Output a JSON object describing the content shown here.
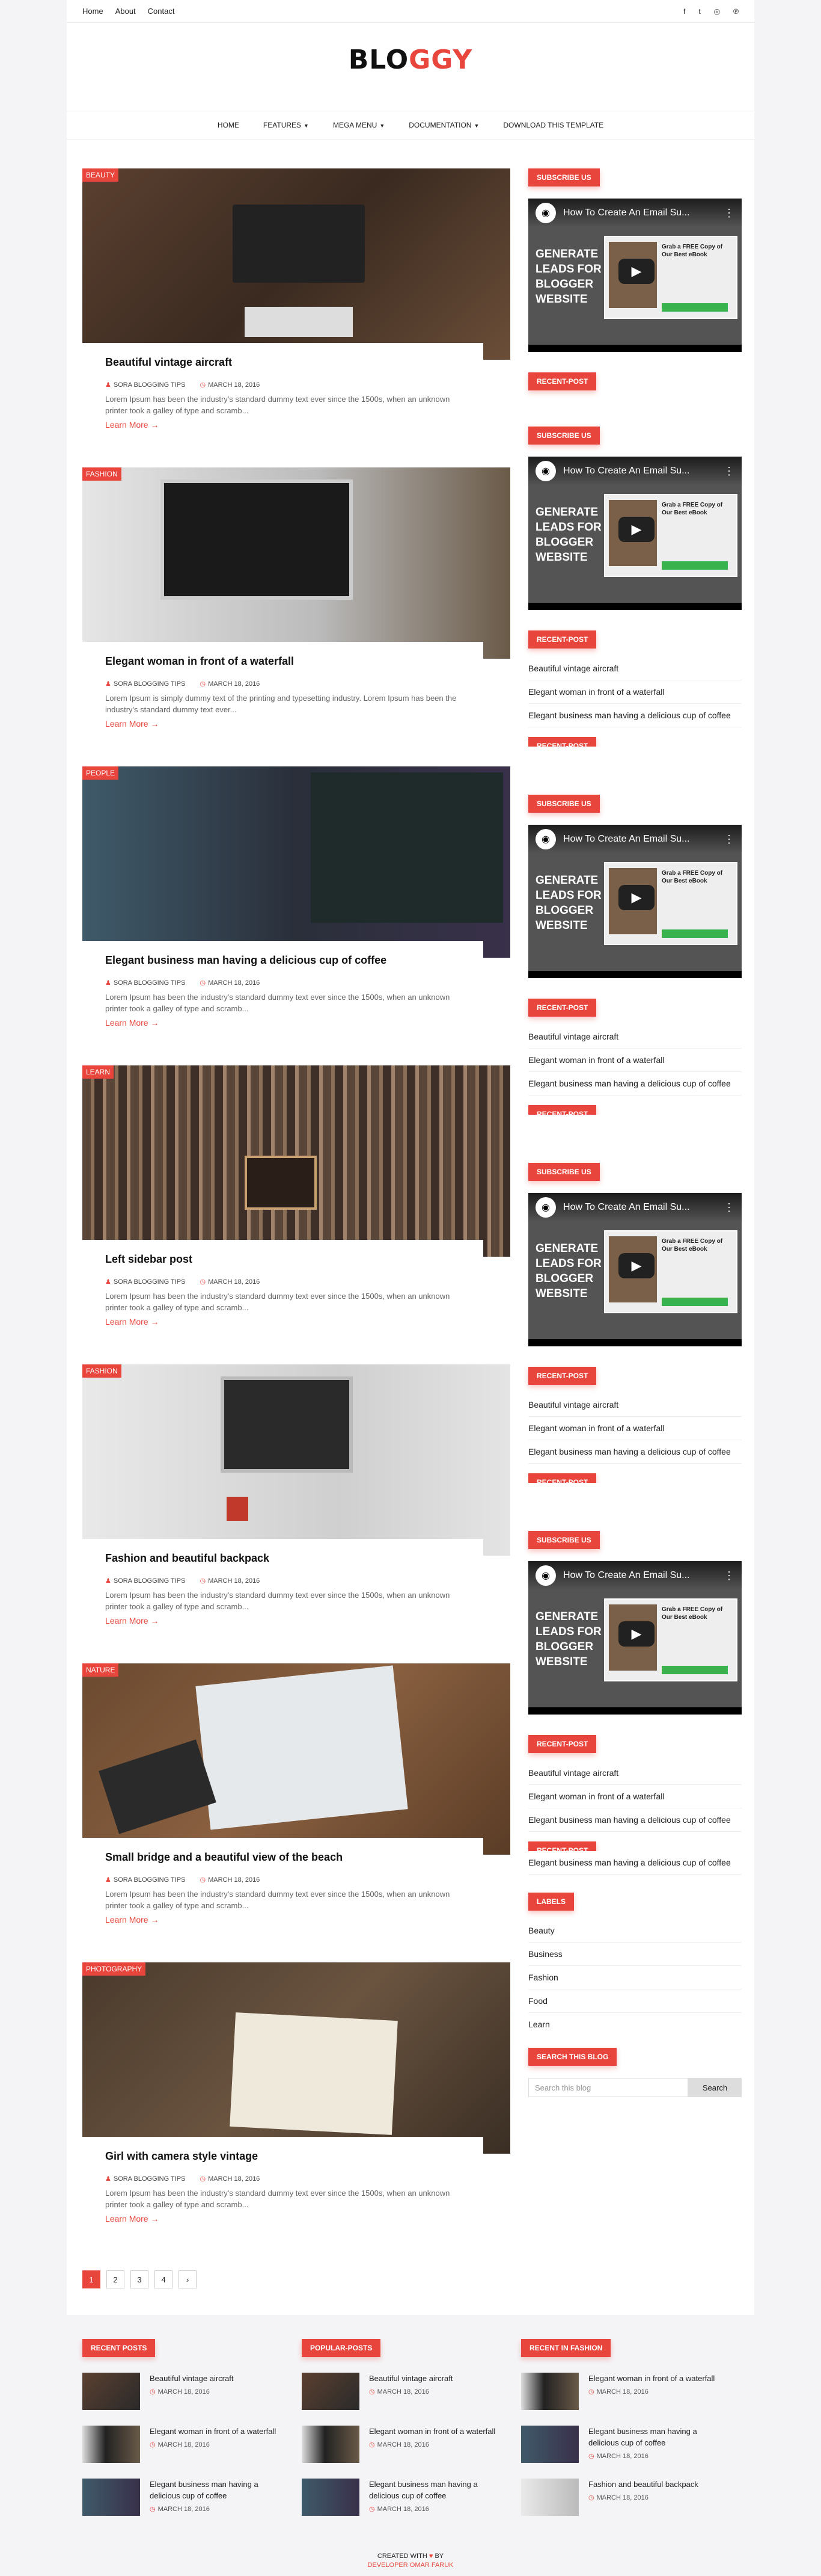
{
  "topnav": {
    "home": "Home",
    "about": "About",
    "contact": "Contact"
  },
  "logo": {
    "part1": "BLO",
    "part2": "GGY"
  },
  "mainnav": {
    "items": [
      "HOME",
      "FEATURES",
      "MEGA MENU",
      "DOCUMENTATION",
      "DOWNLOAD THIS TEMPLATE"
    ]
  },
  "posts": [
    {
      "tag": "BEAUTY",
      "title": "Beautiful vintage aircraft",
      "author": "SORA BLOGGING TIPS",
      "date": "MARCH 18, 2016",
      "excerpt": "Lorem Ipsum has been the industry's standard dummy text ever since the 1500s, when an unknown printer took a galley of type and scramb...",
      "more": "Learn More"
    },
    {
      "tag": "FASHION",
      "title": "Elegant woman in front of a waterfall",
      "author": "SORA BLOGGING TIPS",
      "date": "MARCH 18, 2016",
      "excerpt": "Lorem Ipsum is simply dummy text of the printing and typesetting industry. Lorem Ipsum has been the industry's standard dummy text ever...",
      "more": "Learn More"
    },
    {
      "tag": "PEOPLE",
      "title": "Elegant business man having a delicious cup of coffee",
      "author": "SORA BLOGGING TIPS",
      "date": "MARCH 18, 2016",
      "excerpt": "Lorem Ipsum has been the industry's standard dummy text ever since the 1500s, when an unknown printer took a galley of type and scramb...",
      "more": "Learn More"
    },
    {
      "tag": "LEARN",
      "title": "Left sidebar post",
      "author": "SORA BLOGGING TIPS",
      "date": "MARCH 18, 2016",
      "excerpt": "Lorem Ipsum has been the industry's standard dummy text ever since the 1500s, when an unknown printer took a galley of type and scramb...",
      "more": "Learn More"
    },
    {
      "tag": "FASHION",
      "title": "Fashion and beautiful backpack",
      "author": "SORA BLOGGING TIPS",
      "date": "MARCH 18, 2016",
      "excerpt": "Lorem Ipsum has been the industry's standard dummy text ever since the 1500s, when an unknown printer took a galley of type and scramb...",
      "more": "Learn More"
    },
    {
      "tag": "NATURE",
      "title": "Small bridge and a beautiful view of the beach",
      "author": "SORA BLOGGING TIPS",
      "date": "MARCH 18, 2016",
      "excerpt": "Lorem Ipsum has been the industry's standard dummy text ever since the 1500s, when an unknown printer took a galley of type and scramb...",
      "more": "Learn More"
    },
    {
      "tag": "PHOTOGRAPHY",
      "title": "Girl with camera style vintage",
      "author": "SORA BLOGGING TIPS",
      "date": "MARCH 18, 2016",
      "excerpt": "Lorem Ipsum has been the industry's standard dummy text ever since the 1500s, when an unknown printer took a galley of type and scramb...",
      "more": "Learn More"
    }
  ],
  "pager": [
    "1",
    "2",
    "3",
    "4",
    "›"
  ],
  "sidebar": {
    "subscribe": "SUBSCRIBE US",
    "recent": "RECENT-POST",
    "video": {
      "title": "How To Create An Email Su...",
      "headline": "GENERATE LEADS FOR BLOGGER WEBSITE",
      "ad": "Grab a FREE Copy of Our Best eBook"
    },
    "recent_items": [
      "Beautiful vintage aircraft",
      "Elegant woman in front of a waterfall",
      "Elegant business man having a delicious cup of coffee"
    ],
    "labels_title": "LABELS",
    "labels": [
      "Beauty",
      "Business",
      "Fashion",
      "Food",
      "Learn"
    ],
    "search_title": "SEARCH THIS BLOG",
    "search_placeholder": "Search this blog",
    "search_button": "Search"
  },
  "footer": {
    "cols": [
      {
        "title": "RECENT POSTS",
        "items": [
          {
            "t": "Beautiful vintage aircraft",
            "d": "MARCH 18, 2016"
          },
          {
            "t": "Elegant woman in front of a waterfall",
            "d": "MARCH 18, 2016"
          },
          {
            "t": "Elegant business man having a delicious cup of coffee",
            "d": "MARCH 18, 2016"
          }
        ]
      },
      {
        "title": "POPULAR-POSTS",
        "items": [
          {
            "t": "Beautiful vintage aircraft",
            "d": "MARCH 18, 2016"
          },
          {
            "t": "Elegant woman in front of a waterfall",
            "d": "MARCH 18, 2016"
          },
          {
            "t": "Elegant business man having a delicious cup of coffee",
            "d": "MARCH 18, 2016"
          }
        ]
      },
      {
        "title": "RECENT IN FASHION",
        "items": [
          {
            "t": "Elegant woman in front of a waterfall",
            "d": "MARCH 18, 2016"
          },
          {
            "t": "Elegant business man having a delicious cup of coffee",
            "d": "MARCH 18, 2016"
          },
          {
            "t": "Fashion and beautiful backpack",
            "d": "MARCH 18, 2016"
          }
        ]
      }
    ],
    "credit1": "CREATED WITH",
    "credit2": "BY",
    "credit3": "DEVELOPER OMAR FARUK"
  },
  "colors": {
    "accent": "#e8453c"
  }
}
